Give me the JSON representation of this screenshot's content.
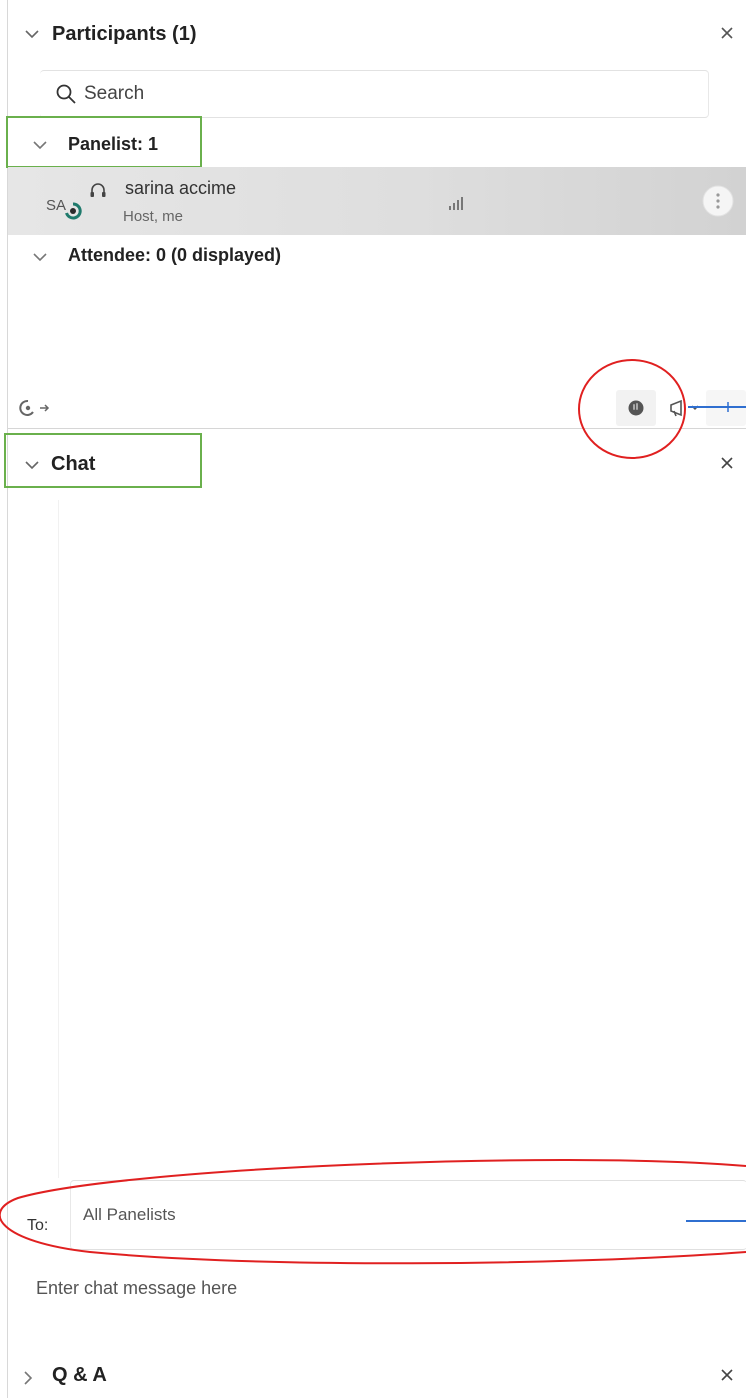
{
  "participants": {
    "title": "Participants (1)",
    "search_placeholder": "Search",
    "panelist_group": "Panelist: 1",
    "attendee_group": "Attendee: 0 (0 displayed)",
    "people": [
      {
        "initials": "SA",
        "name": "sarina accime",
        "role": "Host, me"
      }
    ]
  },
  "chat": {
    "title": "Chat",
    "to_label": "To:",
    "to_value": "All Panelists",
    "message_placeholder": "Enter chat message here"
  },
  "qa": {
    "title": "Q & A"
  },
  "colors": {
    "annotation_red": "#e02020",
    "annotation_green": "#6ab04c",
    "annotation_blue": "#2f6fd0"
  }
}
